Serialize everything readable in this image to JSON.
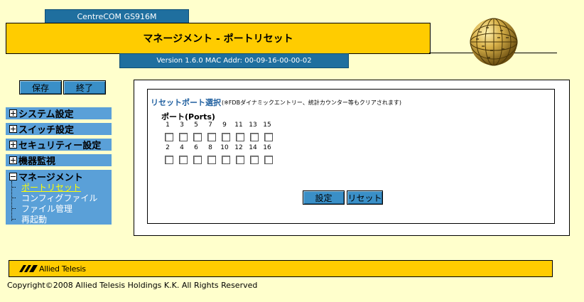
{
  "header": {
    "model": "CentreCOM GS916M",
    "title": "マネージメント - ポートリセット",
    "version": "Version 1.6.0 MAC Addr: 00-09-16-00-00-02"
  },
  "toolbar": {
    "save_label": "保存",
    "exit_label": "終了"
  },
  "sidebar": {
    "system": "システム設定",
    "switch": "スイッチ設定",
    "security": "セキュリティー設定",
    "monitor": "機器監視",
    "management": {
      "label": "マネージメント",
      "items": [
        "ポートリセット",
        "コンフィグファイル",
        "ファイル管理",
        "再起動"
      ]
    }
  },
  "main": {
    "section_title": "リセットポート選択",
    "section_note": "(※FDBダイナミックエントリー、統計カウンター等もクリアされます)",
    "ports_label": "ポート(Ports)",
    "row1_ports": [
      "1",
      "3",
      "5",
      "7",
      "9",
      "11",
      "13",
      "15"
    ],
    "row2_ports": [
      "2",
      "4",
      "6",
      "8",
      "10",
      "12",
      "14",
      "16"
    ],
    "set_label": "設定",
    "reset_label": "リセット"
  },
  "footer": {
    "logo_text": "Allied Telesis",
    "copyright": "Copyright©2008 Allied Telesis Holdings K.K. All Rights Reserved"
  }
}
